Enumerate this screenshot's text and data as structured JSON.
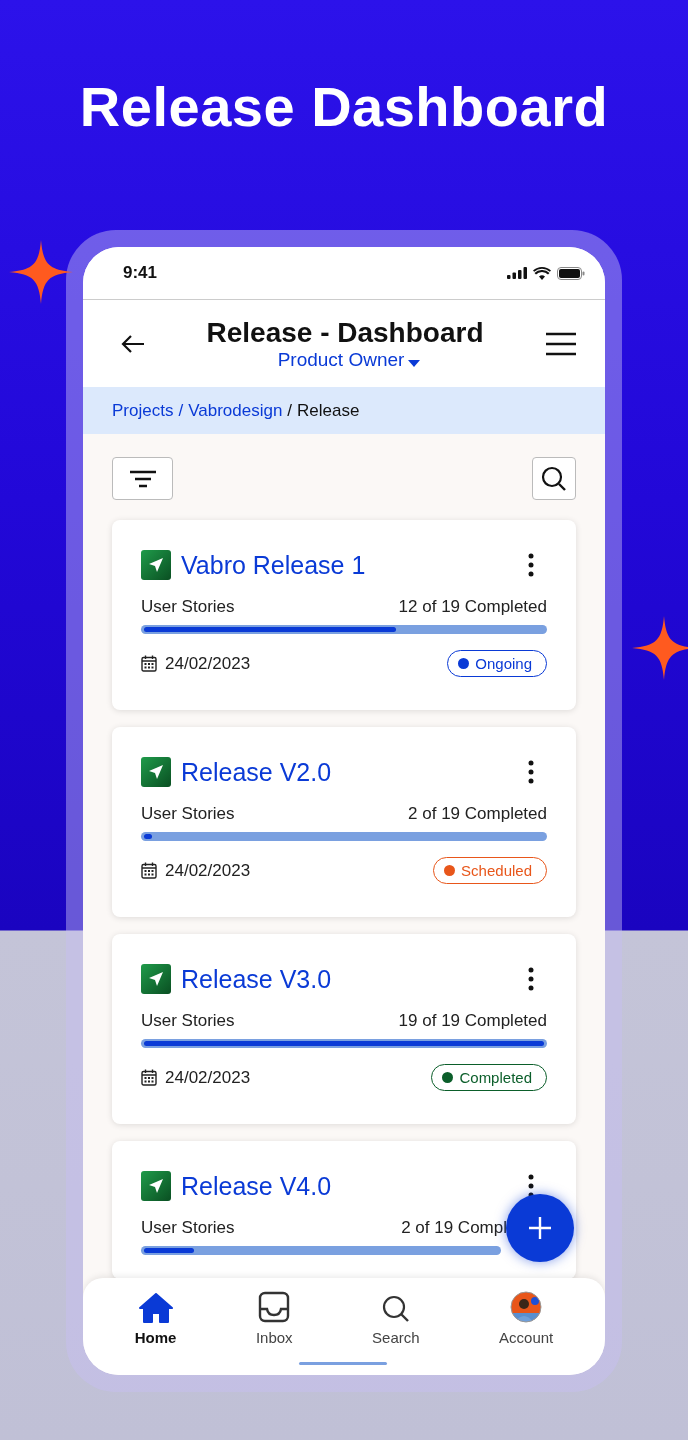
{
  "headline": "Release Dashboard",
  "status_bar": {
    "time": "9:41"
  },
  "header": {
    "title": "Release - Dashboard",
    "subtitle": "Product Owner"
  },
  "breadcrumb": [
    {
      "label": "Projects",
      "kind": "link"
    },
    {
      "label": "/",
      "kind": "separator"
    },
    {
      "label": "Vabrodesign",
      "kind": "link"
    },
    {
      "label": "/",
      "kind": "separator"
    },
    {
      "label": "Release",
      "kind": "current"
    }
  ],
  "cards": [
    {
      "title": "Vabro Release 1",
      "metric": "User Stories",
      "progress": "12 of 19 Completed",
      "level": 0.63,
      "date": "24/02/2023",
      "status": {
        "label": "Ongoing",
        "color": "#0a3ad6"
      }
    },
    {
      "title": "Release V2.0",
      "metric": "User Stories",
      "progress": "2 of 19 Completed",
      "level": 0.02,
      "date": "24/02/2023",
      "status": {
        "label": "Scheduled",
        "color": "#e8561a"
      }
    },
    {
      "title": "Release V3.0",
      "metric": "User Stories",
      "progress": "19 of 19 Completed",
      "level": 1,
      "date": "24/02/2023",
      "status": {
        "label": "Completed",
        "color": "#0b5e2a"
      }
    },
    {
      "title": "Release V4.0",
      "metric": "User Stories",
      "progress": "2 of 19 Compl",
      "level": 0.14
    }
  ],
  "nav": [
    {
      "label": "Home",
      "kind": "home",
      "selected": true
    },
    {
      "label": "Inbox",
      "kind": "inbox",
      "selected": false
    },
    {
      "label": "Search",
      "kind": "search",
      "selected": false
    },
    {
      "label": "Account",
      "kind": "account",
      "selected": false
    }
  ]
}
